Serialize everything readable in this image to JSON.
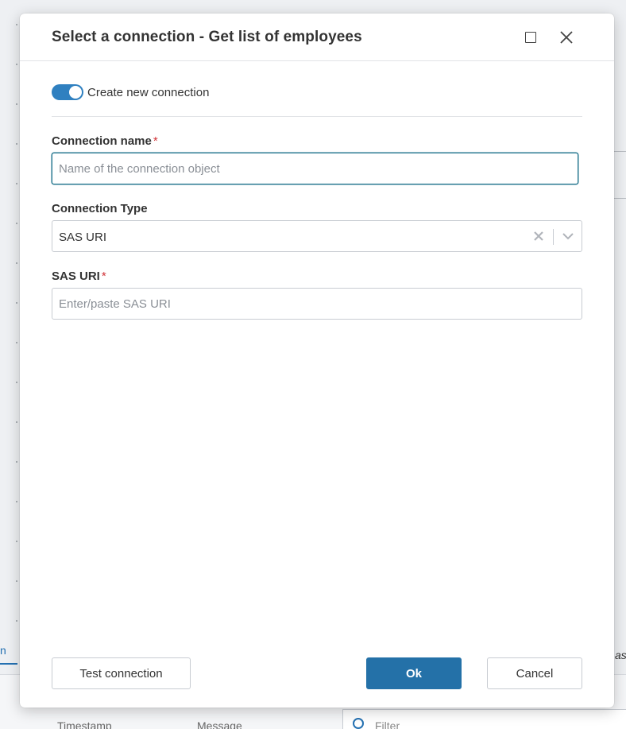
{
  "background": {
    "tab_partial_left": "n",
    "tab_partial_right": "ase",
    "columns": [
      "Timestamp",
      "Message"
    ],
    "filter_placeholder": "Filter"
  },
  "dialog": {
    "title": "Select a connection - Get list of employees",
    "toggle": {
      "label": "Create new connection",
      "checked": true
    },
    "connection_name": {
      "label": "Connection name",
      "required_mark": "*",
      "placeholder": "Name of the connection object",
      "value": ""
    },
    "connection_type": {
      "label": "Connection Type",
      "selected": "SAS URI"
    },
    "sas_uri": {
      "label": "SAS URI",
      "required_mark": "*",
      "placeholder": "Enter/paste SAS URI",
      "value": ""
    },
    "buttons": {
      "test_connection": "Test connection",
      "ok": "Ok",
      "cancel": "Cancel"
    }
  },
  "colors": {
    "accent": "#2471a8",
    "required": "#d13438",
    "focus_border": "#2a7a92"
  }
}
